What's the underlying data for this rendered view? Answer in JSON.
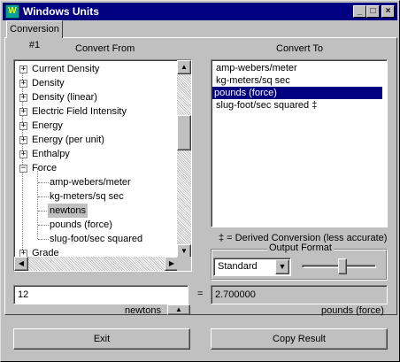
{
  "window": {
    "title": "Windows Units"
  },
  "tabs": [
    {
      "label": "Conversion #1"
    }
  ],
  "convert_from": {
    "heading": "Convert From",
    "tree": [
      {
        "label": "Current Density",
        "expander": "+"
      },
      {
        "label": "Density",
        "expander": "+"
      },
      {
        "label": "Density (linear)",
        "expander": "+"
      },
      {
        "label": "Electric Field Intensity",
        "expander": "+"
      },
      {
        "label": "Energy",
        "expander": "+"
      },
      {
        "label": "Energy (per unit)",
        "expander": "+"
      },
      {
        "label": "Enthalpy",
        "expander": "+"
      },
      {
        "label": "Force",
        "expander": "−"
      },
      {
        "label": "amp-webers/meter"
      },
      {
        "label": "kg-meters/sq sec"
      },
      {
        "label": "newtons",
        "selected": true
      },
      {
        "label": "pounds (force)"
      },
      {
        "label": "slug-foot/sec squared"
      },
      {
        "label": "Grade",
        "expander": "+"
      }
    ]
  },
  "convert_to": {
    "heading": "Convert To",
    "items": [
      {
        "label": "amp-webers/meter"
      },
      {
        "label": "kg-meters/sq sec"
      },
      {
        "label": "pounds (force)",
        "selected": true
      },
      {
        "label": "slug-foot/sec squared ‡"
      }
    ],
    "derived_note": "‡ = Derived Conversion (less accurate)"
  },
  "output_format": {
    "label": "Output Format",
    "selected": "Standard",
    "slider_level": 0.55
  },
  "input": {
    "value": "12",
    "unit": "newtons"
  },
  "equals": "=",
  "result": {
    "value": "2.700000",
    "unit": "pounds (force)"
  },
  "buttons": {
    "exit": "Exit",
    "copy": "Copy Result"
  },
  "colors": {
    "title_bar": "#000080",
    "selection": "#000080",
    "face": "#c0c0c0"
  }
}
